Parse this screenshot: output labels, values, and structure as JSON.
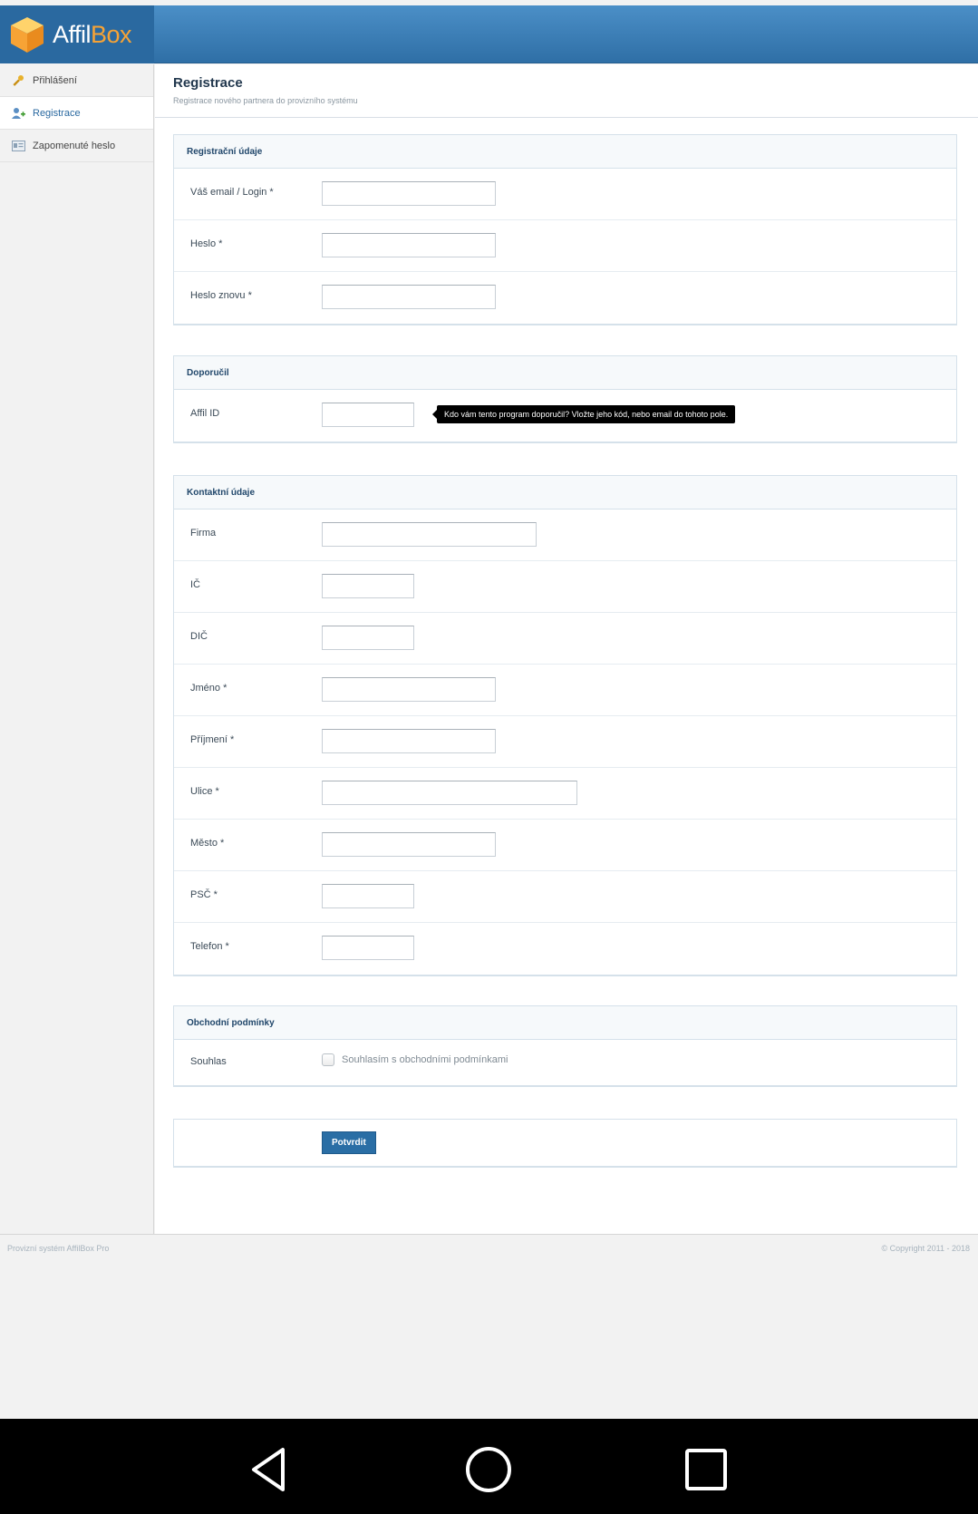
{
  "brand": {
    "part1": "Affil",
    "part2": "Box"
  },
  "sidebar": {
    "items": [
      {
        "label": "Přihlášení",
        "icon": "key-icon"
      },
      {
        "label": "Registrace",
        "icon": "add-user-icon"
      },
      {
        "label": "Zapomenuté heslo",
        "icon": "id-card-icon"
      }
    ]
  },
  "page": {
    "title": "Registrace",
    "subtitle": "Registrace nového partnera do provizního systému"
  },
  "sections": {
    "registration": {
      "title": "Registrační údaje",
      "fields": [
        {
          "label": "Váš email / Login *",
          "value": ""
        },
        {
          "label": "Heslo *",
          "value": ""
        },
        {
          "label": "Heslo znovu *",
          "value": ""
        }
      ]
    },
    "referral": {
      "title": "Doporučil",
      "field": {
        "label": "Affil ID",
        "value": ""
      },
      "tooltip": "Kdo vám tento program doporučil? Vložte jeho kód, nebo email do tohoto pole."
    },
    "contact": {
      "title": "Kontaktní údaje",
      "fields": [
        {
          "label": "Firma",
          "value": ""
        },
        {
          "label": "IČ",
          "value": ""
        },
        {
          "label": "DIČ",
          "value": ""
        },
        {
          "label": "Jméno *",
          "value": ""
        },
        {
          "label": "Příjmení *",
          "value": ""
        },
        {
          "label": "Ulice *",
          "value": ""
        },
        {
          "label": "Město *",
          "value": ""
        },
        {
          "label": "PSČ *",
          "value": ""
        },
        {
          "label": "Telefon *",
          "value": ""
        }
      ]
    },
    "terms": {
      "title": "Obchodní podmínky",
      "label": "Souhlas",
      "checkbox_label": "Souhlasím s obchodními podmínkami",
      "checked": false
    }
  },
  "submit_label": "Potvrdit",
  "footer": {
    "left": "Provizní systém AffilBox Pro",
    "right": "© Copyright 2011 - 2018"
  },
  "colors": {
    "header": "#3a7db8",
    "accent": "#f7a335",
    "button": "#2a6ea5"
  }
}
